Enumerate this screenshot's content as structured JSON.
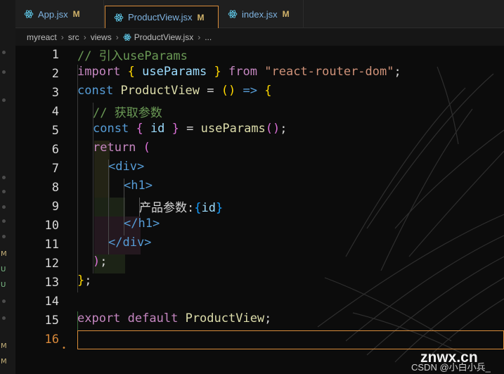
{
  "tabs": [
    {
      "title": "App.jsx",
      "status": "M"
    },
    {
      "title": "ProductView.jsx",
      "status": "M"
    },
    {
      "title": "index.jsx",
      "status": "M"
    }
  ],
  "breadcrumb": [
    "myreact",
    "src",
    "views",
    "ProductView.jsx",
    "..."
  ],
  "line_numbers": [
    "1",
    "2",
    "3",
    "4",
    "5",
    "6",
    "7",
    "8",
    "9",
    "10",
    "11",
    "12",
    "13",
    "14",
    "15",
    "16"
  ],
  "code": {
    "l1": {
      "comment": "// 引入useParams"
    },
    "l2": {
      "import": "import",
      "ob": "{",
      "name": "useParams",
      "cb": "}",
      "from": "from",
      "module": "\"react-router-dom\"",
      "semi": ";"
    },
    "l3": {
      "const": "const",
      "name": "ProductView",
      "eq": "=",
      "parens": "()",
      "arrow": "=>",
      "ob": "{"
    },
    "l4": {
      "comment": "// 获取参数"
    },
    "l5": {
      "const": "const",
      "ob": "{",
      "id": "id",
      "cb": "}",
      "eq": "=",
      "fn": "useParams",
      "parens": "()",
      "semi": ";"
    },
    "l6": {
      "return": "return",
      "op": "("
    },
    "l7": {
      "tag": "<div>"
    },
    "l8": {
      "tag": "<h1>"
    },
    "l9": {
      "text": "产品参数:",
      "ob": "{",
      "id": "id",
      "cb": "}"
    },
    "l10": {
      "tag": "</h1>"
    },
    "l11": {
      "tag": "</div>"
    },
    "l12": {
      "cp": ")",
      "semi": ";"
    },
    "l13": {
      "cb": "}",
      "semi": ";"
    },
    "l15": {
      "export": "export",
      "default": "default",
      "name": "ProductView",
      "semi": ";"
    }
  },
  "sidebar_letters": [
    "M",
    "U",
    "U",
    "M",
    "M"
  ],
  "watermark": {
    "site": "znwx.cn",
    "credit": "CSDN @小白小兵_"
  },
  "colors": {
    "accent": "#d98c3a",
    "comment": "#6a9955",
    "keyword": "#569cd6",
    "string": "#ce9178"
  }
}
